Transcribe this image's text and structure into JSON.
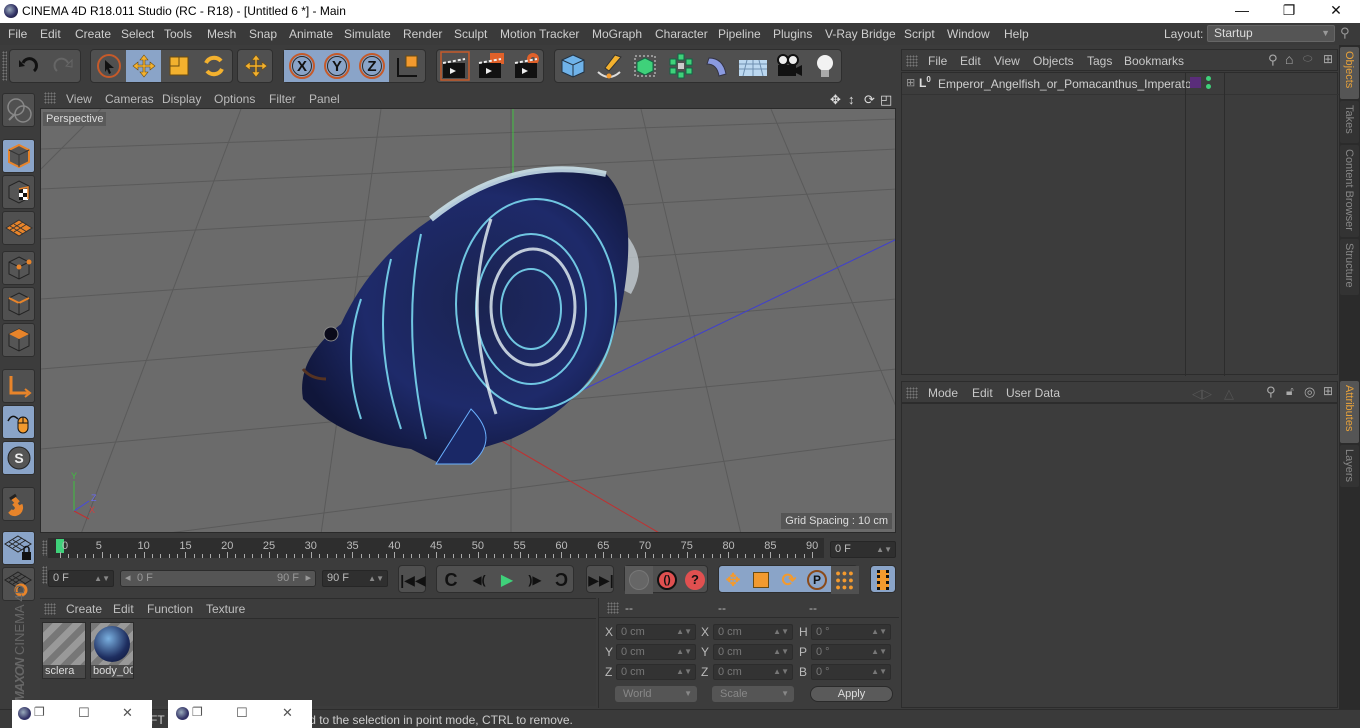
{
  "window": {
    "title": "CINEMA 4D R18.011 Studio (RC - R18) - [Untitled 6 *] - Main",
    "controls": [
      "minimize",
      "restore",
      "close"
    ]
  },
  "menubar": {
    "items": [
      "File",
      "Edit",
      "Create",
      "Select",
      "Tools",
      "Mesh",
      "Snap",
      "Animate",
      "Simulate",
      "Render",
      "Sculpt",
      "Motion Tracker",
      "MoGraph",
      "Character",
      "Pipeline",
      "Plugins",
      "V-Ray Bridge",
      "Script",
      "Window",
      "Help"
    ],
    "layout_label": "Layout:",
    "layout_value": "Startup"
  },
  "toolbar": {
    "groups": [
      {
        "name": "history",
        "items": [
          "undo-icon",
          "redo-icon"
        ]
      },
      {
        "name": "tools",
        "items": [
          "live-selection-icon",
          "move-icon",
          "scale-icon",
          "rotate-icon"
        ]
      },
      {
        "name": "recent",
        "items": [
          "recent-tool-move-icon"
        ]
      },
      {
        "name": "axes",
        "items": [
          "x-axis-lock",
          "y-axis-lock",
          "z-axis-lock",
          "coordinate-system-icon"
        ]
      },
      {
        "name": "render",
        "items": [
          "render-view-icon",
          "render-picture-viewer-icon",
          "render-settings-icon"
        ]
      },
      {
        "name": "objects",
        "items": [
          "cube-icon",
          "pen-spline-icon",
          "subdivision-icon",
          "cloner-icon",
          "deformer-icon",
          "floor-icon",
          "camera-icon",
          "light-icon"
        ]
      }
    ]
  },
  "left_toolbar": {
    "items": [
      "make-editable",
      "model-mode",
      "texture-mode",
      "workplane-mode",
      "points-mode",
      "edges-mode",
      "polygons-mode",
      "axis-mode",
      "tweak-mode",
      "snap-mode",
      "magnet",
      "lock-workplane",
      "workplane-axis"
    ]
  },
  "viewport": {
    "menu": [
      "View",
      "Cameras",
      "Display",
      "Options",
      "Filter",
      "Panel"
    ],
    "camera_label": "Perspective",
    "grid_spacing": "Grid Spacing : 10 cm",
    "axis_labels": {
      "y": "Y",
      "z": "Z",
      "x": "X"
    }
  },
  "timeline": {
    "ticks": [
      "0",
      "5",
      "10",
      "15",
      "20",
      "25",
      "30",
      "35",
      "40",
      "45",
      "50",
      "55",
      "60",
      "65",
      "70",
      "75",
      "80",
      "85",
      "90"
    ],
    "current_frame": "0 F",
    "start_field": "0 F",
    "range_start": "0 F",
    "range_end": "90 F",
    "end_field": "90 F",
    "playhead_frame": 0,
    "max_frame": 90
  },
  "transport": {
    "buttons": [
      "go-to-start",
      "previous-key",
      "previous-frame",
      "play-forward",
      "next-frame",
      "next-key",
      "go-to-end",
      "record-key",
      "auto-key",
      "keyframe-selection",
      "key-position",
      "key-scale",
      "key-rotation",
      "key-parameter",
      "key-pla",
      "timeline-window"
    ]
  },
  "material_manager": {
    "menu": [
      "Create",
      "Edit",
      "Function",
      "Texture"
    ],
    "materials": [
      {
        "name": "sclera"
      },
      {
        "name": "body_00"
      }
    ]
  },
  "coordinates": {
    "headers": [
      "--",
      "--",
      "--"
    ],
    "position": {
      "X": "0 cm",
      "Y": "0 cm",
      "Z": "0 cm"
    },
    "size": {
      "X": "0 cm",
      "Y": "0 cm",
      "Z": "0 cm"
    },
    "rotation": {
      "H": "0 °",
      "P": "0 °",
      "B": "0 °"
    },
    "space_dropdown": "World",
    "mode_dropdown": "Scale",
    "apply_label": "Apply"
  },
  "object_manager": {
    "menu": [
      "File",
      "Edit",
      "View",
      "Objects",
      "Tags",
      "Bookmarks"
    ],
    "objects": [
      {
        "name": "Emperor_Angelfish_or_Pomacanthus_Imperator",
        "tag_color": "#5a2d7a"
      }
    ]
  },
  "attribute_manager": {
    "menu": [
      "Mode",
      "Edit",
      "User Data"
    ]
  },
  "side_tabs": {
    "top": [
      "Objects",
      "Takes",
      "Content Browser",
      "Structure"
    ],
    "bottom": [
      "Attributes",
      "Layers"
    ],
    "active_top": "Objects",
    "active_bottom": "Attributes"
  },
  "branding": {
    "maxon": "MAXON",
    "product": "CINEMA 4D"
  },
  "status": {
    "text": "Move: Click and drag to move elements. Hold down SHIFT to quantize movement / add to the selection in point mode, CTRL to remove.",
    "visible_text": "FT to quantize movement / add to the selection in point mode, CTRL to remove."
  },
  "colors": {
    "accent_orange": "#e8a23a",
    "active_blue": "#8aa4c8",
    "playhead_green": "#3fd17a",
    "panel_bg": "#3c3c3c",
    "viewport_bg": "#6b6b6b"
  }
}
